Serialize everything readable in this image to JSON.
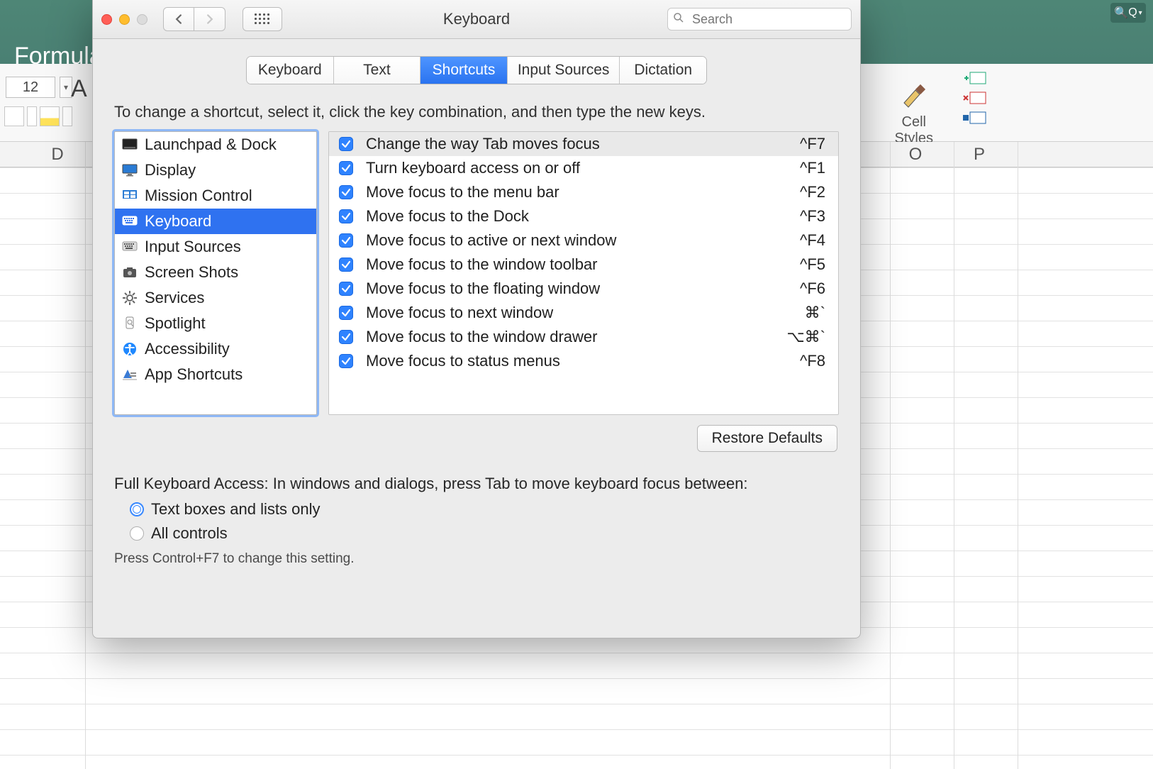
{
  "window": {
    "title": "Keyboard",
    "search_placeholder": "Search"
  },
  "tabs": [
    {
      "label": "Keyboard",
      "active": false
    },
    {
      "label": "Text",
      "active": false
    },
    {
      "label": "Shortcuts",
      "active": true
    },
    {
      "label": "Input Sources",
      "active": false
    },
    {
      "label": "Dictation",
      "active": false
    }
  ],
  "instruction": "To change a shortcut, select it, click the key combination, and then type the new keys.",
  "categories": [
    {
      "label": "Launchpad & Dock",
      "icon": "launchpad",
      "selected": false
    },
    {
      "label": "Display",
      "icon": "display",
      "selected": false
    },
    {
      "label": "Mission Control",
      "icon": "mission",
      "selected": false
    },
    {
      "label": "Keyboard",
      "icon": "keyboard",
      "selected": true
    },
    {
      "label": "Input Sources",
      "icon": "keyboard",
      "selected": false
    },
    {
      "label": "Screen Shots",
      "icon": "screenshot",
      "selected": false
    },
    {
      "label": "Services",
      "icon": "gear",
      "selected": false
    },
    {
      "label": "Spotlight",
      "icon": "spotlight",
      "selected": false
    },
    {
      "label": "Accessibility",
      "icon": "accessibility",
      "selected": false
    },
    {
      "label": "App Shortcuts",
      "icon": "app",
      "selected": false
    }
  ],
  "shortcuts": [
    {
      "checked": true,
      "label": "Change the way Tab moves focus",
      "key": "^F7",
      "selected": true
    },
    {
      "checked": true,
      "label": "Turn keyboard access on or off",
      "key": "^F1"
    },
    {
      "checked": true,
      "label": "Move focus to the menu bar",
      "key": "^F2"
    },
    {
      "checked": true,
      "label": "Move focus to the Dock",
      "key": "^F3"
    },
    {
      "checked": true,
      "label": "Move focus to active or next window",
      "key": "^F4"
    },
    {
      "checked": true,
      "label": "Move focus to the window toolbar",
      "key": "^F5"
    },
    {
      "checked": true,
      "label": "Move focus to the floating window",
      "key": "^F6"
    },
    {
      "checked": true,
      "label": "Move focus to next window",
      "key": "⌘`"
    },
    {
      "checked": true,
      "label": "Move focus to the window drawer",
      "key": "⌥⌘`"
    },
    {
      "checked": true,
      "label": "Move focus to status menus",
      "key": "^F8"
    }
  ],
  "restore_label": "Restore Defaults",
  "fka": {
    "label": "Full Keyboard Access: In windows and dialogs, press Tab to move keyboard focus between:",
    "options": [
      {
        "label": "Text boxes and lists only",
        "selected": true
      },
      {
        "label": "All controls",
        "selected": false
      }
    ],
    "hint": "Press Control+F7 to change this setting."
  },
  "bg": {
    "formula_tab": "Formula",
    "font_size": "12",
    "cell_styles": "Cell\nStyles",
    "cols": {
      "d": "D",
      "o": "O",
      "p": "P"
    },
    "search_q": "Q"
  }
}
